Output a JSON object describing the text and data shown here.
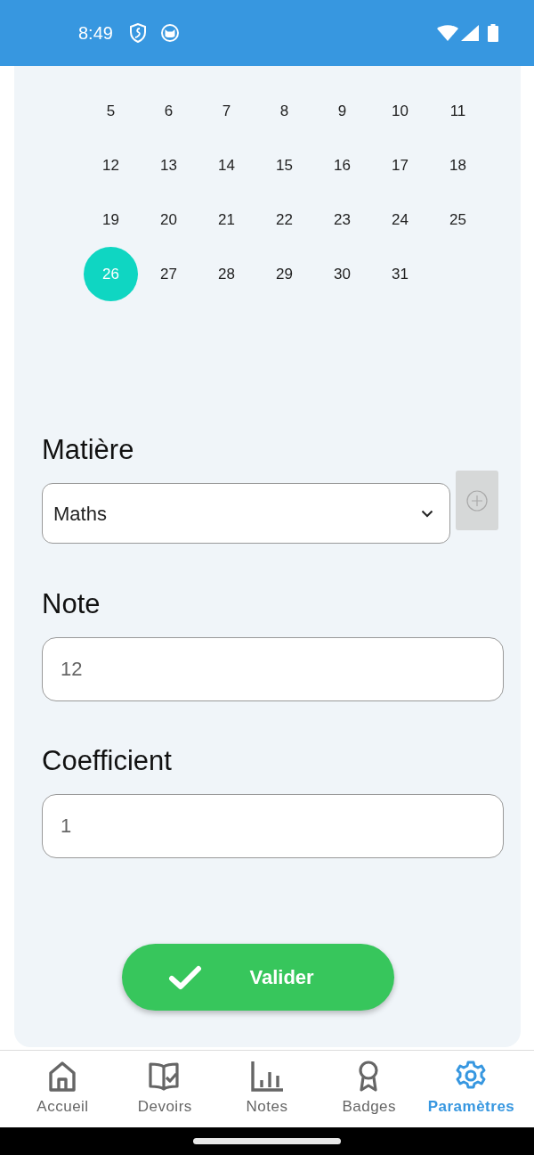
{
  "status_bar": {
    "time": "8:49"
  },
  "calendar": {
    "weeks": [
      [
        {
          "day": "5",
          "selected": false
        },
        {
          "day": "6",
          "selected": false
        },
        {
          "day": "7",
          "selected": false
        },
        {
          "day": "8",
          "selected": false
        },
        {
          "day": "9",
          "selected": false
        },
        {
          "day": "10",
          "selected": false
        },
        {
          "day": "11",
          "selected": false
        }
      ],
      [
        {
          "day": "12",
          "selected": false
        },
        {
          "day": "13",
          "selected": false
        },
        {
          "day": "14",
          "selected": false
        },
        {
          "day": "15",
          "selected": false
        },
        {
          "day": "16",
          "selected": false
        },
        {
          "day": "17",
          "selected": false
        },
        {
          "day": "18",
          "selected": false
        }
      ],
      [
        {
          "day": "19",
          "selected": false
        },
        {
          "day": "20",
          "selected": false
        },
        {
          "day": "21",
          "selected": false
        },
        {
          "day": "22",
          "selected": false
        },
        {
          "day": "23",
          "selected": false
        },
        {
          "day": "24",
          "selected": false
        },
        {
          "day": "25",
          "selected": false
        }
      ],
      [
        {
          "day": "26",
          "selected": true
        },
        {
          "day": "27",
          "selected": false
        },
        {
          "day": "28",
          "selected": false
        },
        {
          "day": "29",
          "selected": false
        },
        {
          "day": "30",
          "selected": false
        },
        {
          "day": "31",
          "selected": false
        }
      ]
    ]
  },
  "form": {
    "subject": {
      "label": "Matière",
      "value": "Maths"
    },
    "grade": {
      "label": "Note",
      "value": "12"
    },
    "coefficient": {
      "label": "Coefficient",
      "value": "1"
    },
    "submit": "Valider"
  },
  "bottom_nav": [
    {
      "label": "Accueil",
      "kind": "home",
      "selected": false
    },
    {
      "label": "Devoirs",
      "kind": "homework",
      "selected": false
    },
    {
      "label": "Notes",
      "kind": "chart",
      "selected": false
    },
    {
      "label": "Badges",
      "kind": "badge",
      "selected": false
    },
    {
      "label": "Paramètres",
      "kind": "settings",
      "selected": true
    }
  ]
}
